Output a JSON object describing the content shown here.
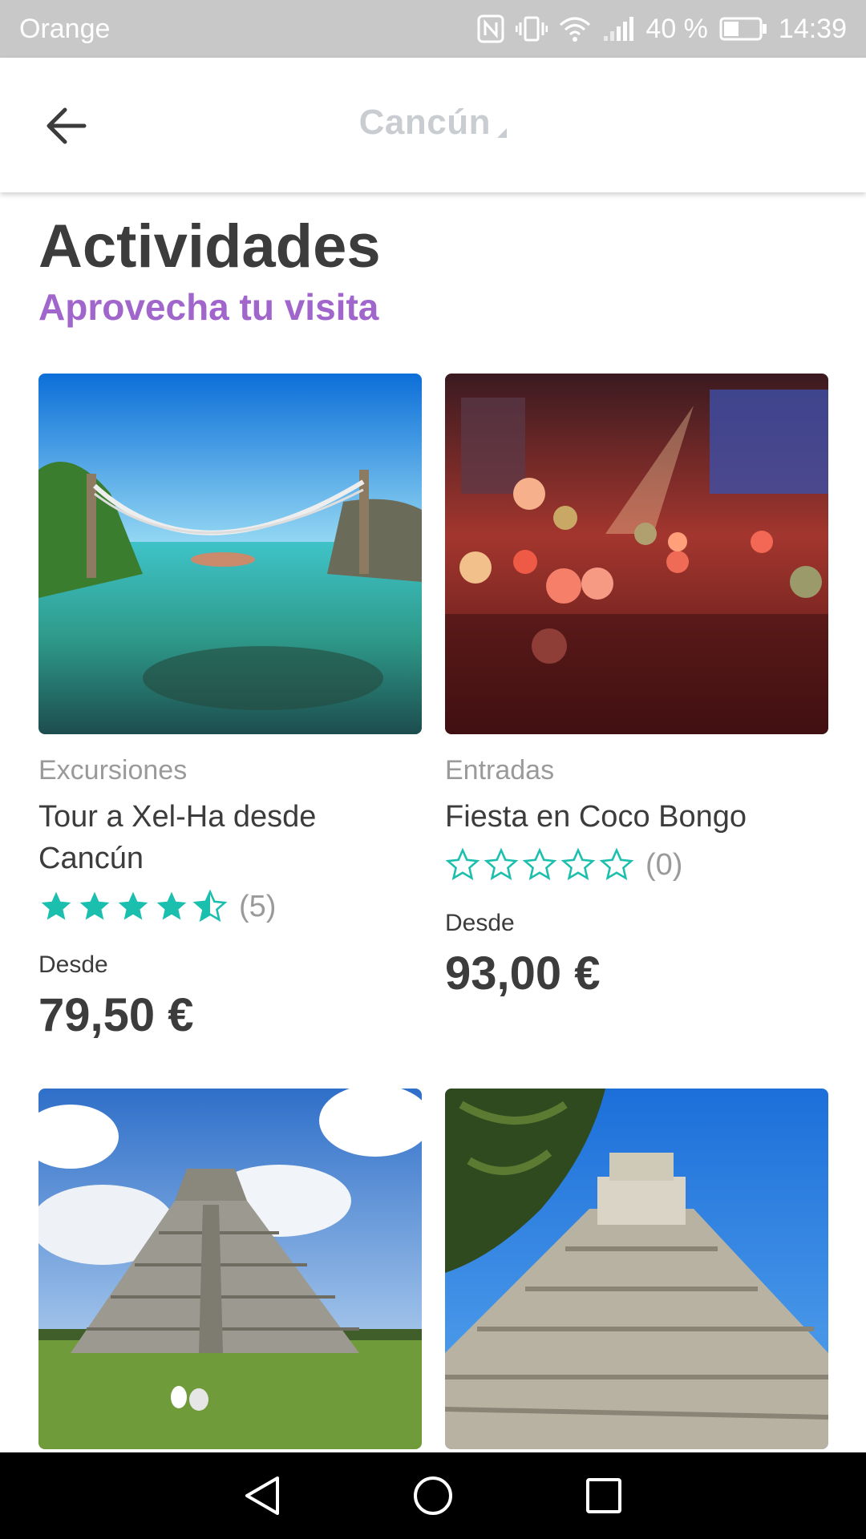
{
  "status_bar": {
    "carrier": "Orange",
    "battery": "40 %",
    "time": "14:39",
    "icons": [
      "nfc-icon",
      "vibrate-icon",
      "wifi-icon",
      "signal-icon",
      "battery-icon"
    ]
  },
  "appbar": {
    "title": "Cancún",
    "back_icon": "arrow-left-icon"
  },
  "section": {
    "title": "Actividades",
    "subtitle": "Aprovecha tu visita"
  },
  "colors": {
    "accent_purple": "#a066cc",
    "star_teal": "#1bbfae",
    "title_grey": "#c9cdd2"
  },
  "cards": [
    {
      "category": "Excursiones",
      "title": "Tour a Xel-Ha desde Cancún",
      "rating": 4.5,
      "rating_count": "(5)",
      "price_label": "Desde",
      "price": "79,50 €",
      "image": "hammock-over-lagoon"
    },
    {
      "category": "Entradas",
      "title": "Fiesta en Coco Bongo",
      "rating": 0,
      "rating_count": "(0)",
      "price_label": "Desde",
      "price": "93,00 €",
      "image": "nightclub-party-balloons"
    },
    {
      "image": "mayan-pyramid-field"
    },
    {
      "image": "mayan-pyramid-closeup"
    }
  ],
  "nav": [
    "back-triangle-icon",
    "home-circle-icon",
    "recents-square-icon"
  ]
}
